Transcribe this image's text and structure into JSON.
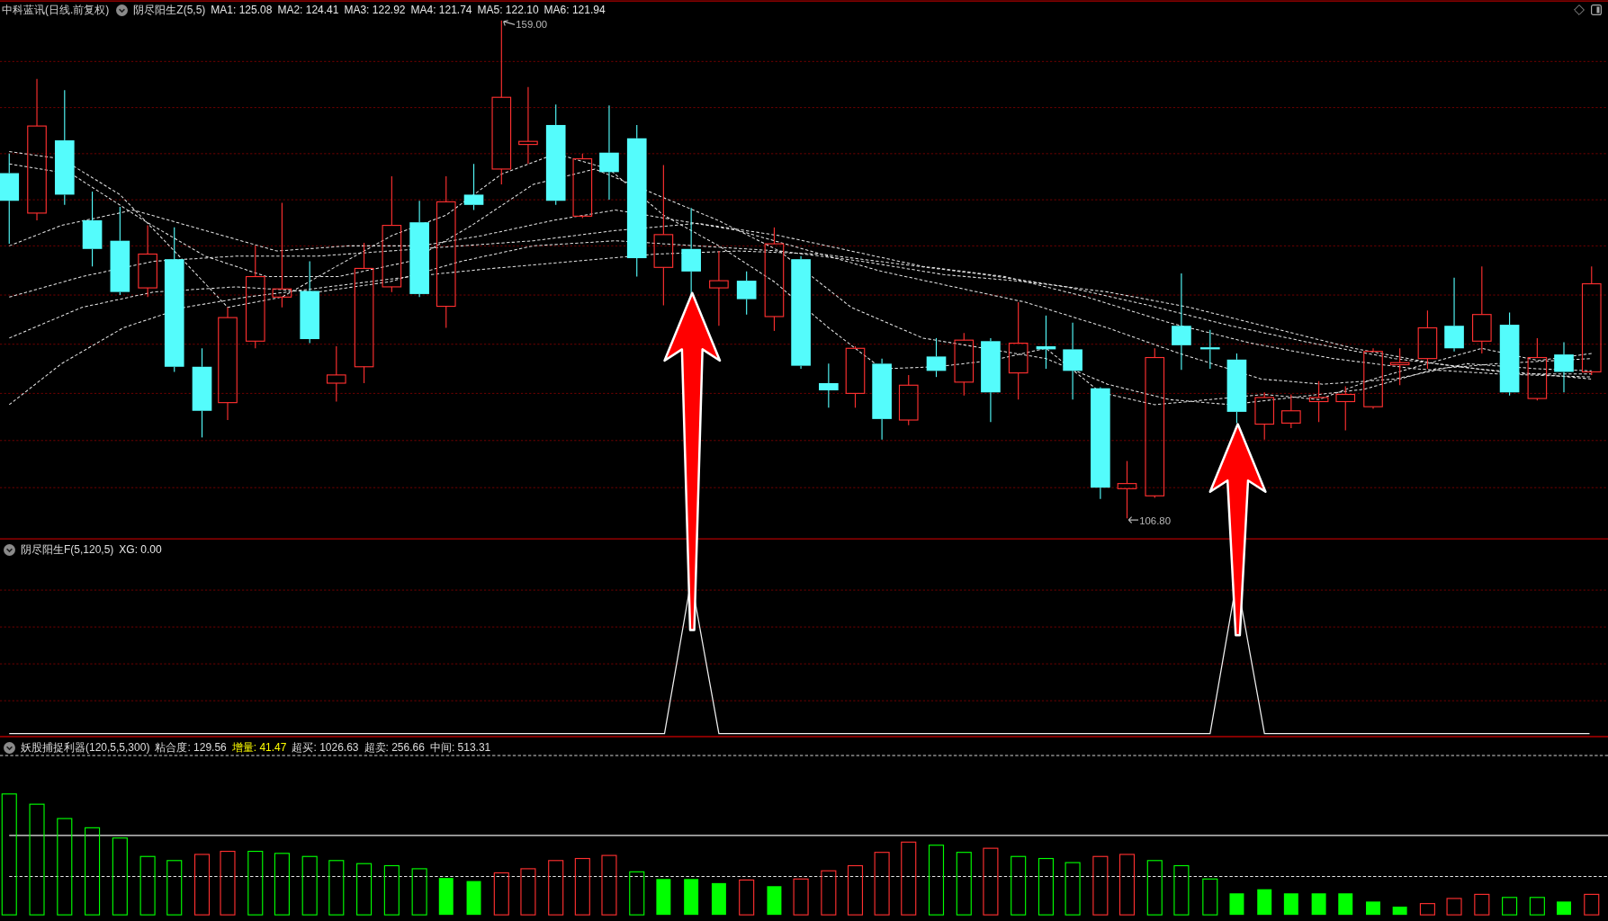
{
  "main_panel": {
    "title": "中科蓝讯(日线.前复权)",
    "indicator": "阴尽阳生Z(5,5)",
    "readings": [
      "MA1: 125.08",
      "MA2: 124.41",
      "MA3: 122.92",
      "MA4: 121.74",
      "MA5: 122.10",
      "MA6: 121.94"
    ],
    "price_marks": [
      {
        "kind": "high",
        "text": "159.00"
      },
      {
        "kind": "low",
        "text": "106.80"
      }
    ]
  },
  "signal_panel": {
    "indicator": "阴尽阳生F(5,120,5)",
    "readings": [
      "XG: 0.00"
    ]
  },
  "oscillator_panel": {
    "indicator": "妖股捕捉利器(120,5,5,300)",
    "readings": [
      {
        "text": "粘合度: 129.56",
        "color": "#dcdcdc"
      },
      {
        "text": "增量: 41.47",
        "color": "#ffff00"
      },
      {
        "text": "超买: 1026.63",
        "color": "#dcdcdc"
      },
      {
        "text": "超卖: 256.66",
        "color": "#dcdcdc"
      },
      {
        "text": "中间: 513.31",
        "color": "#dcdcdc"
      }
    ]
  }
}
